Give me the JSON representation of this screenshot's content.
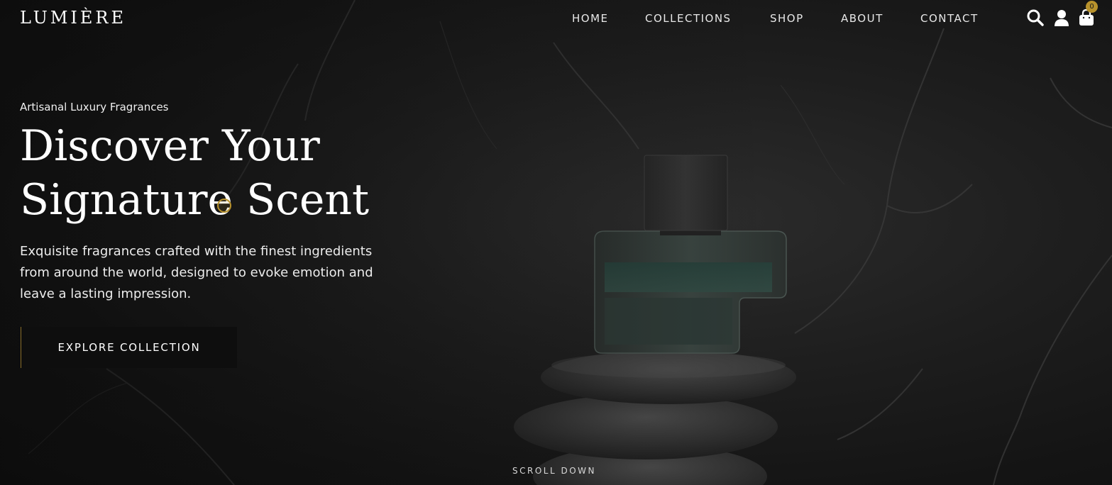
{
  "brand": {
    "logo": "LUMIÈRE"
  },
  "nav": {
    "items": [
      "HOME",
      "COLLECTIONS",
      "SHOP",
      "ABOUT",
      "CONTACT"
    ]
  },
  "header_icons": {
    "search": "search-icon",
    "account": "user-icon",
    "cart": "shopping-bag-icon",
    "cart_count": "0"
  },
  "hero": {
    "eyebrow": "Artisanal Luxury Fragrances",
    "title_line1": "Discover Your",
    "title_line2": "Signature Scent",
    "description": "Exquisite fragrances crafted with the finest ingredients from around the world, designed to evoke emotion and leave a lasting impression.",
    "cta_label": "EXPLORE COLLECTION",
    "scroll_label": "SCROLL DOWN"
  },
  "colors": {
    "accent_gold": "#b8922c",
    "background": "#161616",
    "text": "#ffffff"
  }
}
